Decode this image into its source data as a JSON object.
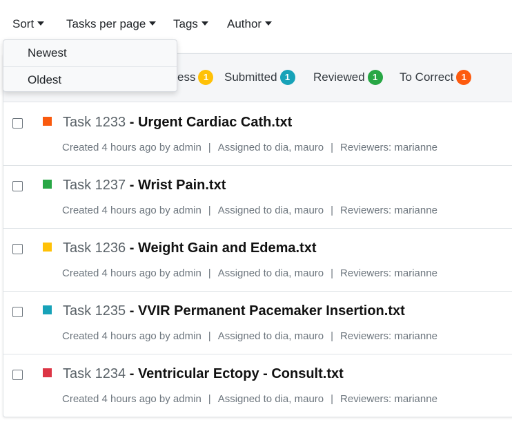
{
  "toolbar": {
    "sort": "Sort",
    "tasks_per_page": "Tasks per page",
    "tags": "Tags",
    "author": "Author"
  },
  "sort_menu": {
    "newest": "Newest",
    "oldest": "Oldest"
  },
  "statuses": [
    {
      "label": "ess",
      "count": "1",
      "color": "#ffc107"
    },
    {
      "label": "Submitted",
      "count": "1",
      "color": "#17a2b8"
    },
    {
      "label": "Reviewed",
      "count": "1",
      "color": "#28a745"
    },
    {
      "label": "To Correct",
      "count": "1",
      "color": "#fd5b0f"
    }
  ],
  "tasks": [
    {
      "number": "Task 1233",
      "name": " - Urgent Cardiac Cath.txt",
      "color": "#f95a0e",
      "created": "Created 4 hours ago by admin",
      "assigned": "Assigned to dia, mauro",
      "reviewers": "Reviewers: marianne"
    },
    {
      "number": "Task 1237",
      "name": " - Wrist Pain.txt",
      "color": "#28a745",
      "created": "Created 4 hours ago by admin",
      "assigned": "Assigned to dia, mauro",
      "reviewers": "Reviewers: marianne"
    },
    {
      "number": "Task 1236",
      "name": " - Weight Gain and Edema.txt",
      "color": "#ffc107",
      "created": "Created 4 hours ago by admin",
      "assigned": "Assigned to dia, mauro",
      "reviewers": "Reviewers: marianne"
    },
    {
      "number": "Task 1235",
      "name": " - VVIR Permanent Pacemaker Insertion.txt",
      "color": "#17a2b8",
      "created": "Created 4 hours ago by admin",
      "assigned": "Assigned to dia, mauro",
      "reviewers": "Reviewers: marianne"
    },
    {
      "number": "Task 1234",
      "name": " - Ventricular Ectopy - Consult.txt",
      "color": "#dc3545",
      "created": "Created 4 hours ago by admin",
      "assigned": "Assigned to dia, mauro",
      "reviewers": "Reviewers: marianne"
    }
  ]
}
